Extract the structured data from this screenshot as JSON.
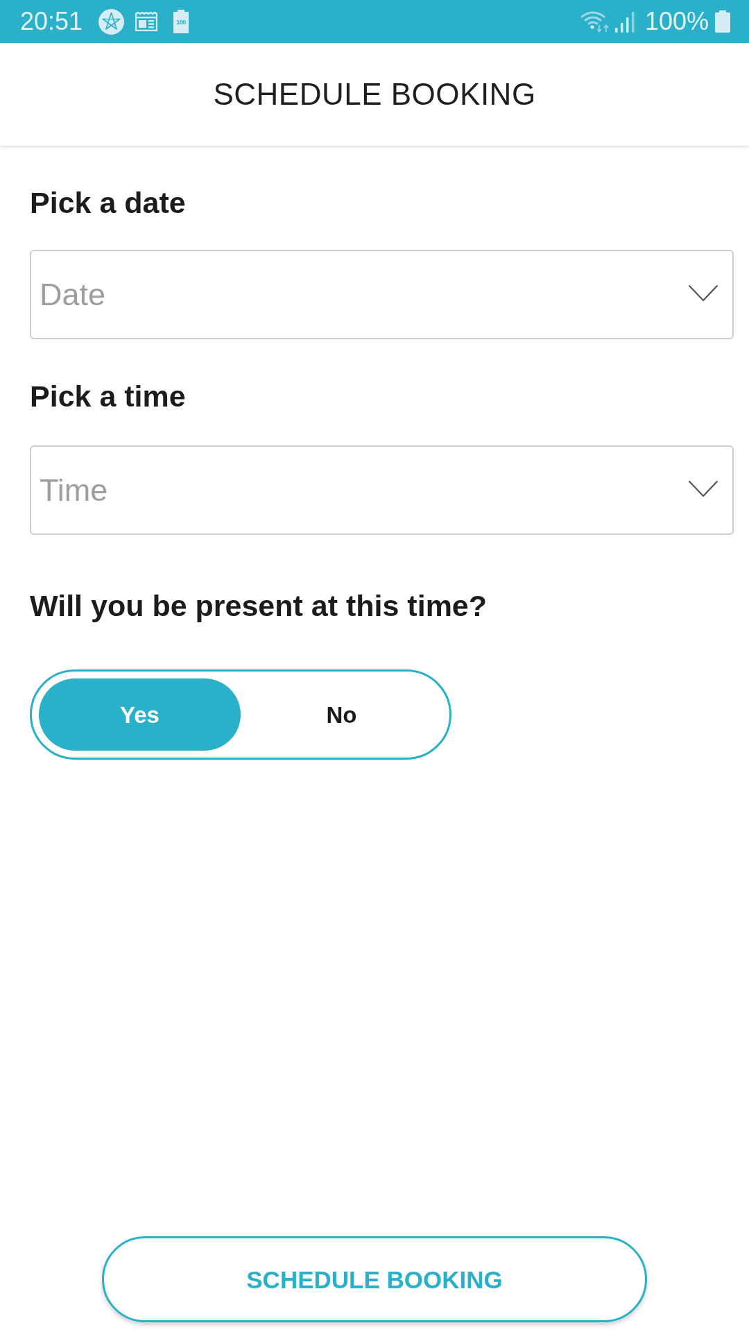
{
  "status_bar": {
    "time": "20:51",
    "notification_badge_text": "100",
    "battery_text": "100%"
  },
  "app_bar": {
    "title": "SCHEDULE BOOKING"
  },
  "form": {
    "fields": [
      {
        "label": "Pick a date",
        "placeholder": "Date"
      },
      {
        "label": "Pick a time",
        "placeholder": "Time"
      }
    ],
    "question": {
      "label": "Will you be present at this time?",
      "options": [
        {
          "label": "Yes",
          "selected": true
        },
        {
          "label": "No",
          "selected": false
        }
      ]
    }
  },
  "submit_button": {
    "label": "SCHEDULE BOOKING"
  }
}
